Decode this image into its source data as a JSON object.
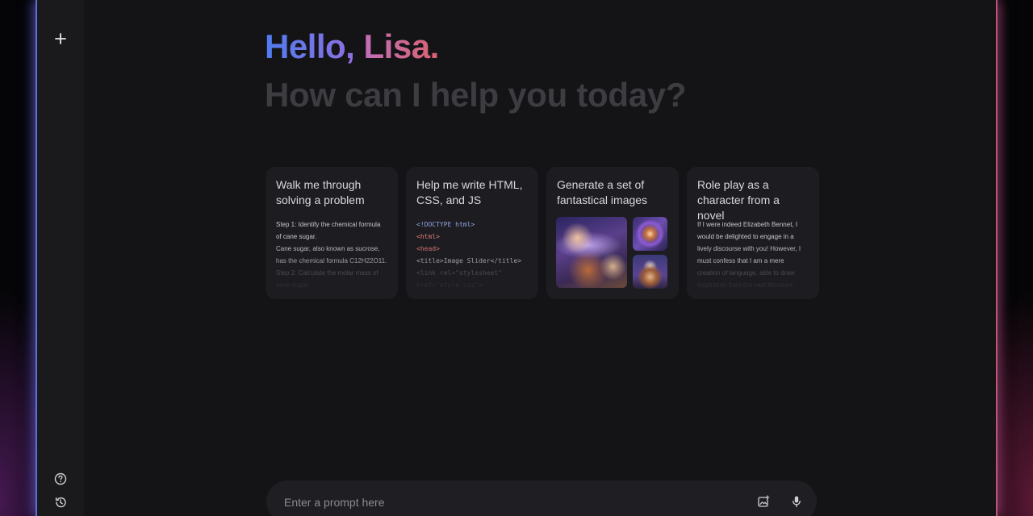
{
  "sidebar": {
    "icons": {
      "new_chat": "plus-icon",
      "help": "help-circle-icon",
      "activity": "history-icon"
    }
  },
  "greeting": {
    "hello": "Hello,",
    "name": "Lisa.",
    "subtitle": "How can I help you today?"
  },
  "cards": [
    {
      "title": "Walk me through solving a problem",
      "lines": [
        "Step 1: Identify the chemical formula",
        "of cane sugar.",
        "Cane sugar, also known as sucrose,",
        "has the chemical formula C12H22O11.",
        "Step 2: Calculate the molar mass of",
        "cane sugar."
      ]
    },
    {
      "title": "Help me write HTML, CSS, and JS",
      "code": [
        "<!DOCTYPE html>",
        "<html>",
        "<head>",
        "<title>Image Slider</title>",
        "<link rel=\"stylesheet\"",
        "href=\"style.css\">"
      ]
    },
    {
      "title": "Generate a set of fantastical images",
      "images": [
        "galaxy-cake-image",
        "spiral-galaxy-image",
        "cosmic-cake-image"
      ]
    },
    {
      "title": "Role play as a character from a novel",
      "lines": [
        "If I were indeed Elizabeth Bennet, I",
        "would be delighted to engage in a",
        "lively discourse with you! However, I",
        "must confess that I am a mere",
        "creation of language, able to draw",
        "inspiration from the vast literature"
      ]
    }
  ],
  "prompt": {
    "placeholder": "Enter a prompt here",
    "icons": {
      "image": "image-upload-icon",
      "mic": "microphone-icon"
    }
  },
  "colors": {
    "accent_blue": "#5b6fd6",
    "accent_pink": "#c4536b",
    "greeting_blue": "#4f7df0",
    "greeting_pink": "#d9626f"
  }
}
